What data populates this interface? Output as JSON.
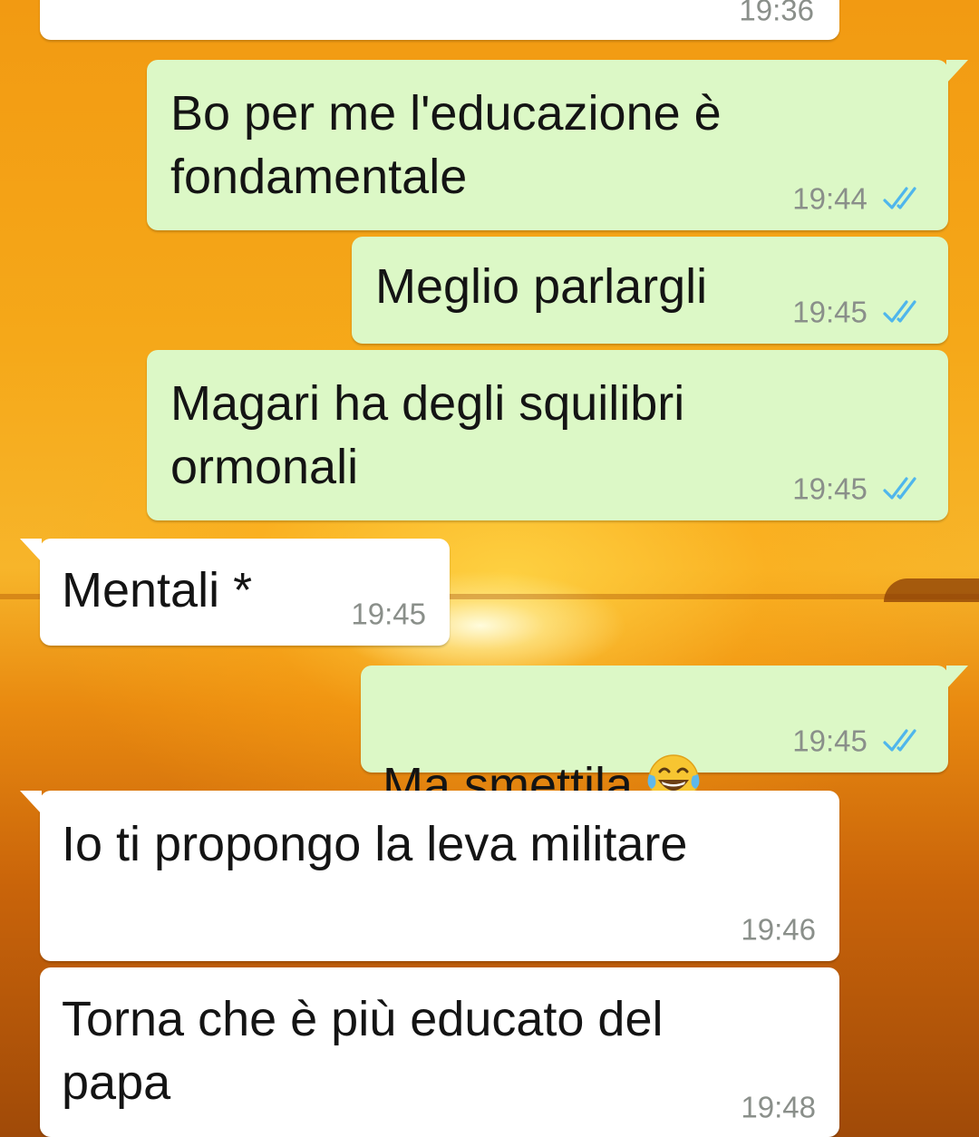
{
  "colors": {
    "outgoing_bubble": "#dcf8c6",
    "incoming_bubble": "#ffffff",
    "read_ticks": "#4fb6ec",
    "timestamp": "#8a8f8a"
  },
  "messages": [
    {
      "direction": "incoming",
      "text": "",
      "time": "19:36",
      "status": ""
    },
    {
      "direction": "outgoing",
      "text": "Bo per me l'educazione è\nfondamentale",
      "time": "19:44",
      "status": "read"
    },
    {
      "direction": "outgoing",
      "text": "Meglio parlargli",
      "time": "19:45",
      "status": "read"
    },
    {
      "direction": "outgoing",
      "text": "Magari ha degli squilibri\normonali",
      "time": "19:45",
      "status": "read"
    },
    {
      "direction": "incoming",
      "text": "Mentali *",
      "time": "19:45",
      "status": ""
    },
    {
      "direction": "outgoing",
      "text": "Ma smettila",
      "emoji": "face-with-tears-of-joy",
      "time": "19:45",
      "status": "read"
    },
    {
      "direction": "incoming",
      "text": "Io ti propongo la leva militare",
      "time": "19:46",
      "status": ""
    },
    {
      "direction": "incoming",
      "text": "Torna che è più educato del\npapa",
      "time": "19:48",
      "status": ""
    }
  ]
}
